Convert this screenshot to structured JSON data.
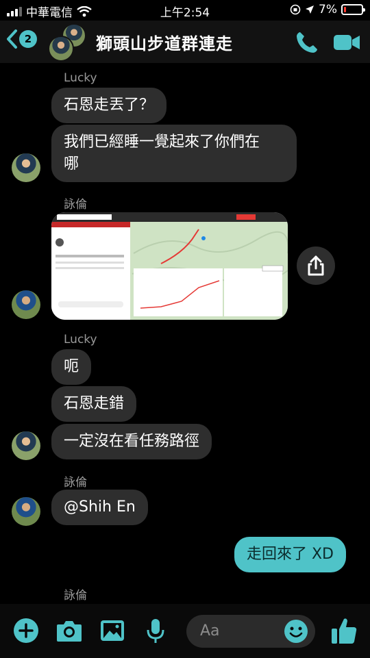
{
  "status_bar": {
    "carrier": "中華電信",
    "time": "上午2:54",
    "battery": "7%"
  },
  "header": {
    "back_count": "2",
    "title": "獅頭山步道群連走"
  },
  "messages": [
    {
      "sender": "Lucky"
    },
    {
      "text": "石恩走丟了？"
    },
    {
      "text": "我們已經睡一覺起來了你們在哪"
    },
    {
      "sender": "詠倫"
    },
    {
      "image": "map-screenshot"
    },
    {
      "sender": "Lucky"
    },
    {
      "text": "呃"
    },
    {
      "text": "石恩走錯"
    },
    {
      "text": "一定沒在看任務路徑"
    },
    {
      "sender": "詠倫"
    },
    {
      "text": "@Shih En"
    },
    {
      "text": "走回來了 XD",
      "outgoing": true
    },
    {
      "sender": "詠倫"
    }
  ],
  "bubble_lines": {
    "line1": "我們已經睡一覺起來了你們在",
    "line2": "哪"
  },
  "composer": {
    "placeholder": "Aa"
  },
  "colors": {
    "accent": "#4fc3c8",
    "bubble_in": "#2e2e2e",
    "background": "#000000"
  }
}
